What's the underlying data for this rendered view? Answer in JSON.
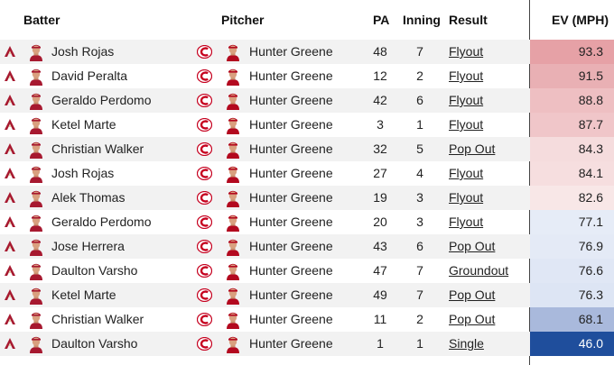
{
  "headers": {
    "batter": "Batter",
    "pitcher": "Pitcher",
    "pa": "PA",
    "inning": "Inning",
    "result": "Result",
    "ev": "EV (MPH)"
  },
  "rows": [
    {
      "batter": "Josh Rojas",
      "pitcher": "Hunter Greene",
      "pa": "48",
      "inning": "7",
      "result": "Flyout",
      "ev": "93.3",
      "ev_color": "#e6a1a6"
    },
    {
      "batter": "David Peralta",
      "pitcher": "Hunter Greene",
      "pa": "12",
      "inning": "2",
      "result": "Flyout",
      "ev": "91.5",
      "ev_color": "#e9b0b4"
    },
    {
      "batter": "Geraldo Perdomo",
      "pitcher": "Hunter Greene",
      "pa": "42",
      "inning": "6",
      "result": "Flyout",
      "ev": "88.8",
      "ev_color": "#eebfc2"
    },
    {
      "batter": "Ketel Marte",
      "pitcher": "Hunter Greene",
      "pa": "3",
      "inning": "1",
      "result": "Flyout",
      "ev": "87.7",
      "ev_color": "#f0c6c9"
    },
    {
      "batter": "Christian Walker",
      "pitcher": "Hunter Greene",
      "pa": "32",
      "inning": "5",
      "result": "Pop Out",
      "ev": "84.3",
      "ev_color": "#f5dcdd"
    },
    {
      "batter": "Josh Rojas",
      "pitcher": "Hunter Greene",
      "pa": "27",
      "inning": "4",
      "result": "Flyout",
      "ev": "84.1",
      "ev_color": "#f6dedf"
    },
    {
      "batter": "Alek Thomas",
      "pitcher": "Hunter Greene",
      "pa": "19",
      "inning": "3",
      "result": "Flyout",
      "ev": "82.6",
      "ev_color": "#f8e7e7"
    },
    {
      "batter": "Geraldo Perdomo",
      "pitcher": "Hunter Greene",
      "pa": "20",
      "inning": "3",
      "result": "Flyout",
      "ev": "77.1",
      "ev_color": "#e6ecf7"
    },
    {
      "batter": "Jose Herrera",
      "pitcher": "Hunter Greene",
      "pa": "43",
      "inning": "6",
      "result": "Pop Out",
      "ev": "76.9",
      "ev_color": "#e4eaf6"
    },
    {
      "batter": "Daulton Varsho",
      "pitcher": "Hunter Greene",
      "pa": "47",
      "inning": "7",
      "result": "Groundout",
      "ev": "76.6",
      "ev_color": "#e0e7f5"
    },
    {
      "batter": "Ketel Marte",
      "pitcher": "Hunter Greene",
      "pa": "49",
      "inning": "7",
      "result": "Pop Out",
      "ev": "76.3",
      "ev_color": "#dde5f4"
    },
    {
      "batter": "Christian Walker",
      "pitcher": "Hunter Greene",
      "pa": "11",
      "inning": "2",
      "result": "Pop Out",
      "ev": "68.1",
      "ev_color": "#a9b9dc"
    },
    {
      "batter": "Daulton Varsho",
      "pitcher": "Hunter Greene",
      "pa": "1",
      "inning": "1",
      "result": "Single",
      "ev": "46.0",
      "ev_color": "#1f4e9c",
      "ev_text_color": "#ffffff"
    }
  ]
}
